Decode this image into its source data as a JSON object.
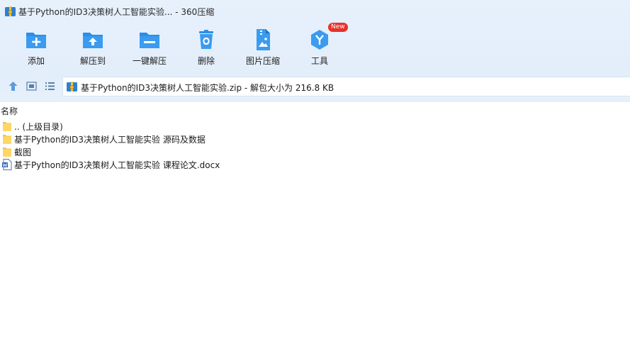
{
  "window": {
    "title": "基于Python的ID3决策树人工智能实验... - 360压缩"
  },
  "toolbar": {
    "buttons": [
      {
        "label": "添加"
      },
      {
        "label": "解压到"
      },
      {
        "label": "一键解压"
      },
      {
        "label": "删除"
      },
      {
        "label": "图片压缩"
      },
      {
        "label": "工具",
        "badge": "New"
      }
    ]
  },
  "address": {
    "text": "基于Python的ID3决策树人工智能实验.zip - 解包大小为 216.8 KB"
  },
  "file_list": {
    "column_name": "名称",
    "rows": [
      {
        "name": ".. (上级目录)",
        "icon": "folder-icon"
      },
      {
        "name": "基于Python的ID3决策树人工智能实验 源码及数据",
        "icon": "folder-icon"
      },
      {
        "name": "截图",
        "icon": "folder-icon"
      },
      {
        "name": "基于Python的ID3决策树人工智能实验 课程论文.docx",
        "icon": "word-doc-icon"
      }
    ]
  },
  "colors": {
    "accent": "#2b8ee8",
    "header_bg": "#e6f0fb",
    "badge": "#e8312a"
  }
}
